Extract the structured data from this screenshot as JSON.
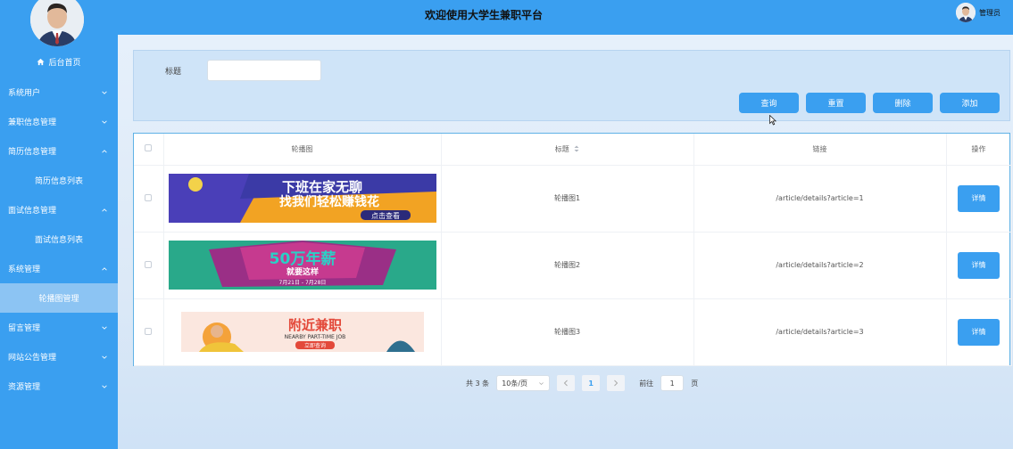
{
  "app": {
    "title": "欢迎使用大学生兼职平台"
  },
  "user": {
    "name": "管理员"
  },
  "sidebar": {
    "home": "后台首页",
    "items": [
      {
        "label": "系统用户",
        "expanded": false
      },
      {
        "label": "兼职信息管理",
        "expanded": false
      },
      {
        "label": "简历信息管理",
        "expanded": true,
        "sub": "简历信息列表"
      },
      {
        "label": "面试信息管理",
        "expanded": true,
        "sub": "面试信息列表"
      },
      {
        "label": "系统管理",
        "expanded": true,
        "sub": "轮播图管理"
      },
      {
        "label": "留言管理",
        "expanded": false
      },
      {
        "label": "网站公告管理",
        "expanded": false
      },
      {
        "label": "资源管理",
        "expanded": false
      }
    ]
  },
  "search": {
    "label": "标题",
    "value": "",
    "placeholder": ""
  },
  "toolbar": {
    "query": "查询",
    "reset": "重置",
    "delete": "删除",
    "add": "添加"
  },
  "table": {
    "headers": {
      "image": "轮播图",
      "title": "标题",
      "link": "链接",
      "action": "操作"
    },
    "rows": [
      {
        "banner_text1": "下班在家无聊",
        "banner_text2": "找我们轻松赚钱花",
        "banner_text3": "点击查看",
        "title": "轮播图1",
        "link": "/article/details?article=1",
        "action": "详情"
      },
      {
        "banner_text1": "50万年薪",
        "banner_text2": "就要这样",
        "banner_text3": "7月21日 - 7月28日",
        "title": "轮播图2",
        "link": "/article/details?article=2",
        "action": "详情"
      },
      {
        "banner_text1": "附近兼职",
        "banner_text2": "NEARBY PART-TIME JOB",
        "banner_text3": "立即查询",
        "title": "轮播图3",
        "link": "/article/details?article=3",
        "action": "详情"
      }
    ]
  },
  "pagination": {
    "total": "共 3 条",
    "page_size": "10条/页",
    "current": "1",
    "goto_label": "前往",
    "goto_value": "1",
    "page_suffix": "页"
  },
  "colors": {
    "primary": "#3a9ff0",
    "active_menu": "#8cc4f3",
    "panel": "#cfe4f8"
  }
}
